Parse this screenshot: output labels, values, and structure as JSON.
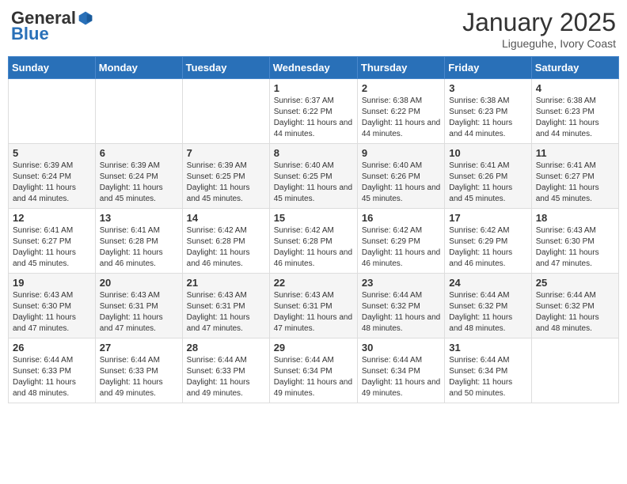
{
  "header": {
    "logo_general": "General",
    "logo_blue": "Blue",
    "month_title": "January 2025",
    "subtitle": "Ligueguhe, Ivory Coast"
  },
  "weekdays": [
    "Sunday",
    "Monday",
    "Tuesday",
    "Wednesday",
    "Thursday",
    "Friday",
    "Saturday"
  ],
  "weeks": [
    [
      {
        "day": "",
        "sunrise": "",
        "sunset": "",
        "daylight": ""
      },
      {
        "day": "",
        "sunrise": "",
        "sunset": "",
        "daylight": ""
      },
      {
        "day": "",
        "sunrise": "",
        "sunset": "",
        "daylight": ""
      },
      {
        "day": "1",
        "sunrise": "Sunrise: 6:37 AM",
        "sunset": "Sunset: 6:22 PM",
        "daylight": "Daylight: 11 hours and 44 minutes."
      },
      {
        "day": "2",
        "sunrise": "Sunrise: 6:38 AM",
        "sunset": "Sunset: 6:22 PM",
        "daylight": "Daylight: 11 hours and 44 minutes."
      },
      {
        "day": "3",
        "sunrise": "Sunrise: 6:38 AM",
        "sunset": "Sunset: 6:23 PM",
        "daylight": "Daylight: 11 hours and 44 minutes."
      },
      {
        "day": "4",
        "sunrise": "Sunrise: 6:38 AM",
        "sunset": "Sunset: 6:23 PM",
        "daylight": "Daylight: 11 hours and 44 minutes."
      }
    ],
    [
      {
        "day": "5",
        "sunrise": "Sunrise: 6:39 AM",
        "sunset": "Sunset: 6:24 PM",
        "daylight": "Daylight: 11 hours and 44 minutes."
      },
      {
        "day": "6",
        "sunrise": "Sunrise: 6:39 AM",
        "sunset": "Sunset: 6:24 PM",
        "daylight": "Daylight: 11 hours and 45 minutes."
      },
      {
        "day": "7",
        "sunrise": "Sunrise: 6:39 AM",
        "sunset": "Sunset: 6:25 PM",
        "daylight": "Daylight: 11 hours and 45 minutes."
      },
      {
        "day": "8",
        "sunrise": "Sunrise: 6:40 AM",
        "sunset": "Sunset: 6:25 PM",
        "daylight": "Daylight: 11 hours and 45 minutes."
      },
      {
        "day": "9",
        "sunrise": "Sunrise: 6:40 AM",
        "sunset": "Sunset: 6:26 PM",
        "daylight": "Daylight: 11 hours and 45 minutes."
      },
      {
        "day": "10",
        "sunrise": "Sunrise: 6:41 AM",
        "sunset": "Sunset: 6:26 PM",
        "daylight": "Daylight: 11 hours and 45 minutes."
      },
      {
        "day": "11",
        "sunrise": "Sunrise: 6:41 AM",
        "sunset": "Sunset: 6:27 PM",
        "daylight": "Daylight: 11 hours and 45 minutes."
      }
    ],
    [
      {
        "day": "12",
        "sunrise": "Sunrise: 6:41 AM",
        "sunset": "Sunset: 6:27 PM",
        "daylight": "Daylight: 11 hours and 45 minutes."
      },
      {
        "day": "13",
        "sunrise": "Sunrise: 6:41 AM",
        "sunset": "Sunset: 6:28 PM",
        "daylight": "Daylight: 11 hours and 46 minutes."
      },
      {
        "day": "14",
        "sunrise": "Sunrise: 6:42 AM",
        "sunset": "Sunset: 6:28 PM",
        "daylight": "Daylight: 11 hours and 46 minutes."
      },
      {
        "day": "15",
        "sunrise": "Sunrise: 6:42 AM",
        "sunset": "Sunset: 6:28 PM",
        "daylight": "Daylight: 11 hours and 46 minutes."
      },
      {
        "day": "16",
        "sunrise": "Sunrise: 6:42 AM",
        "sunset": "Sunset: 6:29 PM",
        "daylight": "Daylight: 11 hours and 46 minutes."
      },
      {
        "day": "17",
        "sunrise": "Sunrise: 6:42 AM",
        "sunset": "Sunset: 6:29 PM",
        "daylight": "Daylight: 11 hours and 46 minutes."
      },
      {
        "day": "18",
        "sunrise": "Sunrise: 6:43 AM",
        "sunset": "Sunset: 6:30 PM",
        "daylight": "Daylight: 11 hours and 47 minutes."
      }
    ],
    [
      {
        "day": "19",
        "sunrise": "Sunrise: 6:43 AM",
        "sunset": "Sunset: 6:30 PM",
        "daylight": "Daylight: 11 hours and 47 minutes."
      },
      {
        "day": "20",
        "sunrise": "Sunrise: 6:43 AM",
        "sunset": "Sunset: 6:31 PM",
        "daylight": "Daylight: 11 hours and 47 minutes."
      },
      {
        "day": "21",
        "sunrise": "Sunrise: 6:43 AM",
        "sunset": "Sunset: 6:31 PM",
        "daylight": "Daylight: 11 hours and 47 minutes."
      },
      {
        "day": "22",
        "sunrise": "Sunrise: 6:43 AM",
        "sunset": "Sunset: 6:31 PM",
        "daylight": "Daylight: 11 hours and 47 minutes."
      },
      {
        "day": "23",
        "sunrise": "Sunrise: 6:44 AM",
        "sunset": "Sunset: 6:32 PM",
        "daylight": "Daylight: 11 hours and 48 minutes."
      },
      {
        "day": "24",
        "sunrise": "Sunrise: 6:44 AM",
        "sunset": "Sunset: 6:32 PM",
        "daylight": "Daylight: 11 hours and 48 minutes."
      },
      {
        "day": "25",
        "sunrise": "Sunrise: 6:44 AM",
        "sunset": "Sunset: 6:32 PM",
        "daylight": "Daylight: 11 hours and 48 minutes."
      }
    ],
    [
      {
        "day": "26",
        "sunrise": "Sunrise: 6:44 AM",
        "sunset": "Sunset: 6:33 PM",
        "daylight": "Daylight: 11 hours and 48 minutes."
      },
      {
        "day": "27",
        "sunrise": "Sunrise: 6:44 AM",
        "sunset": "Sunset: 6:33 PM",
        "daylight": "Daylight: 11 hours and 49 minutes."
      },
      {
        "day": "28",
        "sunrise": "Sunrise: 6:44 AM",
        "sunset": "Sunset: 6:33 PM",
        "daylight": "Daylight: 11 hours and 49 minutes."
      },
      {
        "day": "29",
        "sunrise": "Sunrise: 6:44 AM",
        "sunset": "Sunset: 6:34 PM",
        "daylight": "Daylight: 11 hours and 49 minutes."
      },
      {
        "day": "30",
        "sunrise": "Sunrise: 6:44 AM",
        "sunset": "Sunset: 6:34 PM",
        "daylight": "Daylight: 11 hours and 49 minutes."
      },
      {
        "day": "31",
        "sunrise": "Sunrise: 6:44 AM",
        "sunset": "Sunset: 6:34 PM",
        "daylight": "Daylight: 11 hours and 50 minutes."
      },
      {
        "day": "",
        "sunrise": "",
        "sunset": "",
        "daylight": ""
      }
    ]
  ]
}
